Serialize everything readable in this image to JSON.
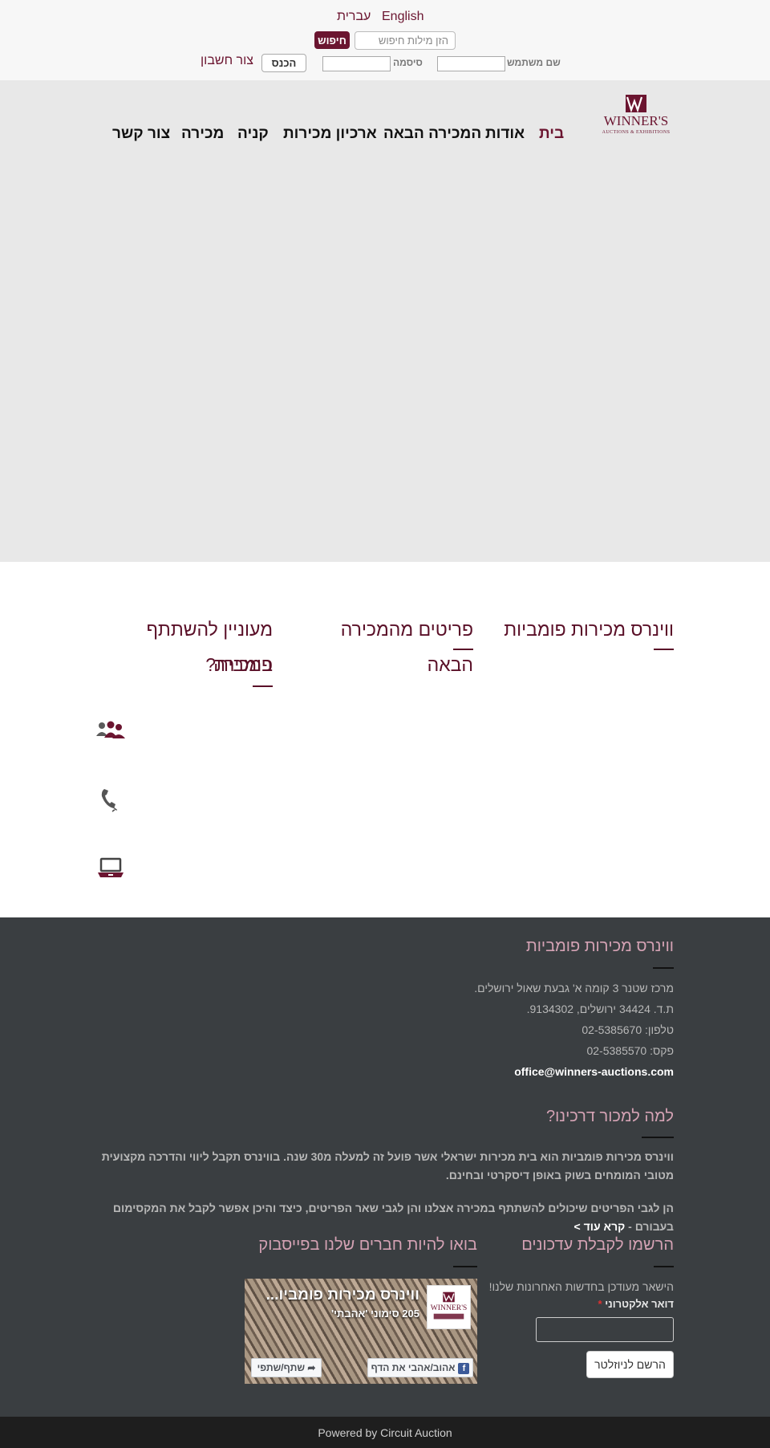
{
  "top_bar": {
    "language_english": "English",
    "language_hebrew": "עברית",
    "search": {
      "placeholder": "הזן מילות חיפוש",
      "value": "",
      "button_label": "חיפוש"
    },
    "login": {
      "username_label": "שם משתמש",
      "username_value": "",
      "password_label": "סיסמה",
      "password_value": "",
      "login_button": "הכנס",
      "create_account_link": "צור חשבון"
    }
  },
  "header": {
    "logo_icon": "winners-logo",
    "logo_lettering": "WINNER'S AUCTIONS & EXHIBITIONS",
    "nav": [
      "בית",
      "אודות",
      "המכירה הבאה",
      "ארכיון מכירות",
      "קניה",
      "מכירה",
      "צור קשר"
    ],
    "active_nav": "בית"
  },
  "content": {
    "col1_title": "ווינרס מכירות פומביות",
    "col2_title": "פריטים מהמכירה הבאה",
    "col3_title_line1": "מעוניין להשתתף במכירה",
    "col3_title_line2": "פומבית?",
    "participation_icons": [
      "people-icon",
      "phone-icon",
      "laptop-icon"
    ]
  },
  "footer": {
    "company_title": "ווינרס מכירות פומביות",
    "address": "מרכז שטנר 3 קומה א' גבעת שאול ירושלים.",
    "po_box": "ת.ד. 34424 ירושלים, 9134302.",
    "phone": "טלפון: 02-5385670",
    "fax": "פקס: 02-5385570",
    "email": "office@winners-auctions.com",
    "why_title": "למה למכור דרכינו?",
    "why_paragraph": "ווינרס מכירות פומביות הוא בית מכירות ישראלי אשר פועל זה למעלה מ30 שנה. בווינרס תקבל ליווי והדרכה מקצועית מטובי המומחים בשוק באופן דיסקרטי ובחינם.",
    "items_paragraph": "הן לגבי הפריטים שיכולים להשתתף במכירה אצלנו והן לגבי שאר הפריטים, כיצד והיכן אפשר לקבל את המקסימום בעבורם - ",
    "read_more": "קרא עוד >",
    "newsletter_title": "הרשמו לקבלת עדכונים",
    "newsletter_text": "הישאר מעודכן בחדשות האחרונות שלנו!",
    "email_label": "דואר אלקטרוני",
    "required_mark": "*",
    "email_value": "",
    "subscribe_button": "הרשם לניוזלטר",
    "facebook_title": "בואו להיות חברים שלנו בפייסבוק",
    "facebook_page_name": "ווינרס מכירות פומביו...",
    "facebook_likes": "205 סימוני 'אהבתי'",
    "facebook_like_button": "אהוב/אהבי את הדף",
    "facebook_share_button": "שתף/שתפי",
    "powered_by": "Powered by Circuit Auction"
  },
  "colors": {
    "brand": "#6b1530",
    "footer_bg": "#3a3e41",
    "footer_title": "#d4a2b4",
    "hero_bg": "#e8e8e8",
    "bottom_bar": "#1e1e1e"
  }
}
